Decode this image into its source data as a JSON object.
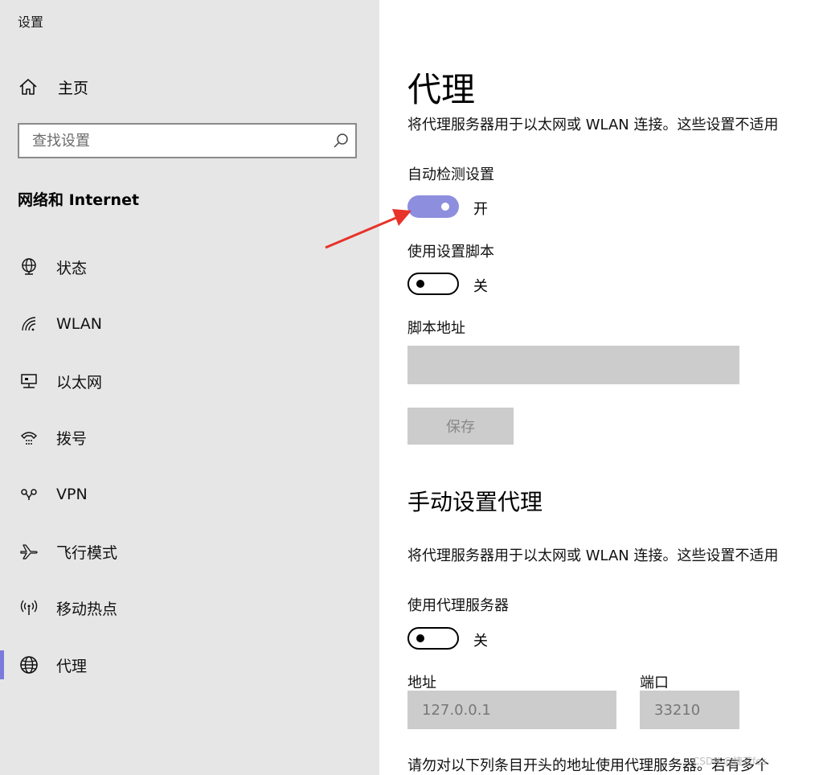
{
  "window": {
    "title": "设置"
  },
  "sidebar": {
    "home_label": "主页",
    "search_placeholder": "查找设置",
    "section_title": "网络和 Internet",
    "items": [
      {
        "label": "状态",
        "icon": "status-globe-icon",
        "selected": false
      },
      {
        "label": "WLAN",
        "icon": "wifi-icon",
        "selected": false
      },
      {
        "label": "以太网",
        "icon": "ethernet-icon",
        "selected": false
      },
      {
        "label": "拨号",
        "icon": "dialup-icon",
        "selected": false
      },
      {
        "label": "VPN",
        "icon": "vpn-icon",
        "selected": false
      },
      {
        "label": "飞行模式",
        "icon": "airplane-icon",
        "selected": false
      },
      {
        "label": "移动热点",
        "icon": "hotspot-icon",
        "selected": false
      },
      {
        "label": "代理",
        "icon": "proxy-globe-icon",
        "selected": true
      }
    ],
    "accent_color": "#7b7bdc"
  },
  "main": {
    "title": "代理",
    "auto_section": {
      "description": "将代理服务器用于以太网或 WLAN 连接。这些设置不适用",
      "auto_detect_label": "自动检测设置",
      "auto_detect_state": "开",
      "auto_detect_on": true,
      "use_script_label": "使用设置脚本",
      "use_script_state": "关",
      "use_script_on": false,
      "script_address_label": "脚本地址",
      "script_address_value": "",
      "save_label": "保存"
    },
    "manual_section": {
      "title": "手动设置代理",
      "description": "将代理服务器用于以太网或 WLAN 连接。这些设置不适用",
      "use_proxy_label": "使用代理服务器",
      "use_proxy_state": "关",
      "use_proxy_on": false,
      "address_label": "地址",
      "address_value": "127.0.0.1",
      "port_label": "端口",
      "port_value": "33210",
      "exceptions_text": "请勿对以下列条目开头的地址使用代理服务器。若有多个"
    },
    "toggle_on_color": "#8e8edf"
  },
  "annotation": {
    "arrow_color": "#e8322a"
  },
  "watermark": "CSDN @捷若fes"
}
